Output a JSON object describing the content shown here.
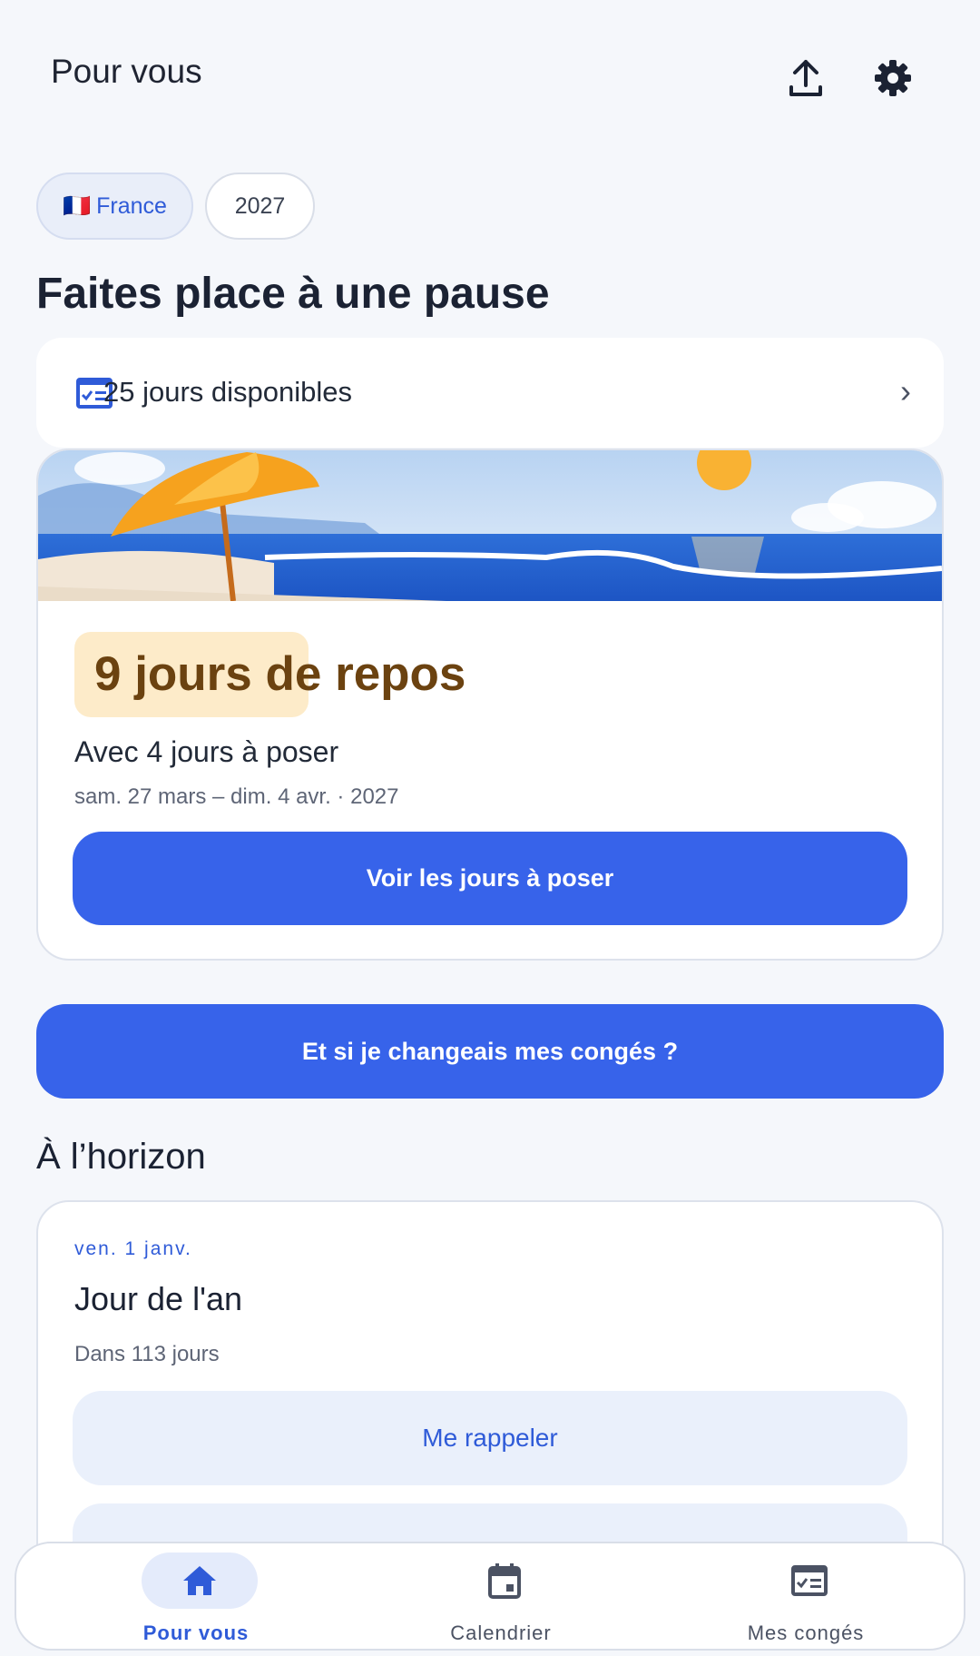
{
  "header": {
    "title": "Pour vous",
    "share_icon": "share-upload-icon",
    "settings_icon": "gear-icon"
  },
  "filters": {
    "country_flag": "🇫🇷",
    "country": "France",
    "year": "2027"
  },
  "section": {
    "title": "Faites place à une pause"
  },
  "days_card": {
    "icon": "checklist-icon",
    "label": "25 jours disponibles"
  },
  "promo": {
    "badge": "9 jours de repos",
    "subtitle": "Avec 4 jours à poser",
    "dates": "sam. 27 mars – dim. 4 avr. · 2027",
    "button": "Voir les jours à poser"
  },
  "change_button": "Et si je changeais mes congés ?",
  "horizon": {
    "title": "À l’horizon",
    "items": [
      {
        "date": "ven. 1 janv.",
        "name": "Jour de l'an",
        "countdown": "Dans 113 jours",
        "button": "Me rappeler"
      }
    ]
  },
  "bottom_nav": [
    {
      "label": "Pour vous",
      "icon": "home-icon",
      "active": true
    },
    {
      "label": "Calendrier",
      "icon": "calendar-icon",
      "active": false
    },
    {
      "label": "Mes congés",
      "icon": "checklist-icon",
      "active": false
    }
  ],
  "colors": {
    "accent": "#3763EA",
    "background": "#F5F7FB",
    "badge_bg": "#FDEBC9",
    "badge_text": "#6B4210"
  }
}
